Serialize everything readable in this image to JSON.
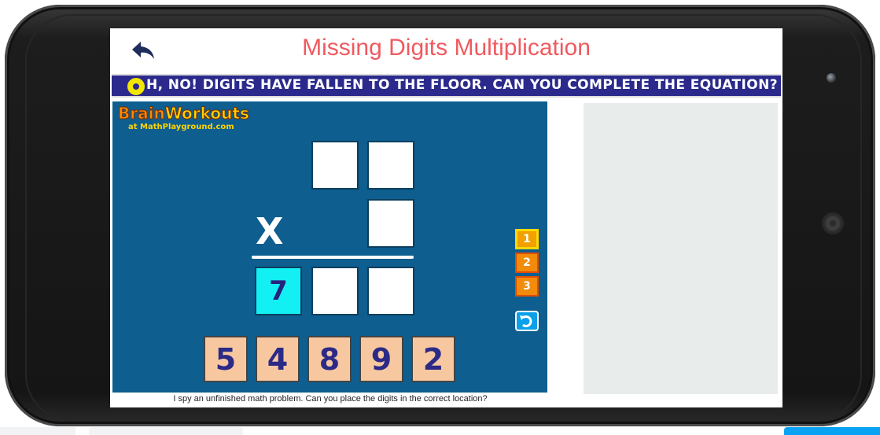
{
  "app": {
    "title": "Missing Digits Multiplication"
  },
  "banner": {
    "text": "H, NO! DIGITS HAVE FALLEN TO THE FLOOR. CAN YOU COMPLETE THE EQUATION?"
  },
  "game": {
    "logo_brain": "Brain",
    "logo_workouts": "Workouts",
    "logo_sub": "at MathPlayground.com",
    "operator": "X",
    "product_first_digit": "7",
    "level_buttons": [
      "1",
      "2",
      "3"
    ],
    "active_level": "1",
    "digit_tiles": [
      "5",
      "4",
      "8",
      "9",
      "2"
    ]
  },
  "caption": "I spy an unfinished math problem. Can you place the digits in the correct location?",
  "colors": {
    "title": "#ef5a5f",
    "banner": "#2b2a8c",
    "game_bg": "#0e5e8f",
    "tile": "#f7c8a0",
    "filled_box": "#13f0f4"
  }
}
